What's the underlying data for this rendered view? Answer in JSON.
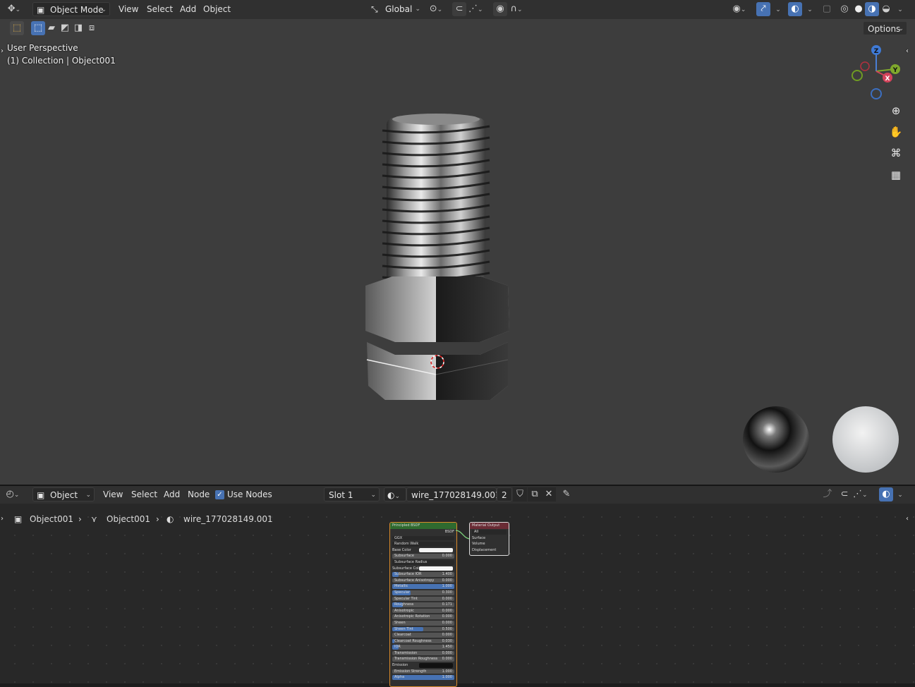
{
  "top_header": {
    "mode": "Object Mode",
    "menus": [
      "View",
      "Select",
      "Add",
      "Object"
    ],
    "orientation": "Global",
    "options": "Options"
  },
  "viewport": {
    "perspective": "User Perspective",
    "collection": "(1) Collection | Object001",
    "gizmo": {
      "z": "Z",
      "y": "Y",
      "x": "X"
    }
  },
  "node_header": {
    "object_type": "Object",
    "menus": [
      "View",
      "Select",
      "Add",
      "Node"
    ],
    "use_nodes": "Use Nodes",
    "slot": "Slot 1",
    "material_name": "wire_177028149.001",
    "user_count": "2"
  },
  "breadcrumb": [
    "Object001",
    "Object001",
    "wire_177028149.001"
  ],
  "nodes": {
    "principled": {
      "title": "Principled BSDF",
      "output": "BSDF",
      "rows": [
        {
          "label": "GGX",
          "kind": "select",
          "value": ""
        },
        {
          "label": "Random Walk",
          "kind": "select",
          "value": ""
        },
        {
          "label": "Base Color",
          "kind": "color",
          "value": ""
        },
        {
          "label": "Subsurface",
          "kind": "num",
          "value": "0.000",
          "fill": 0
        },
        {
          "label": "Subsurface Radius",
          "kind": "select",
          "value": ""
        },
        {
          "label": "Subsurface Color",
          "kind": "color",
          "value": ""
        },
        {
          "label": "Subsurface IOR",
          "kind": "num",
          "value": "1.400",
          "fill": 0.1
        },
        {
          "label": "Subsurface Anisotropy",
          "kind": "num",
          "value": "0.000",
          "fill": 0
        },
        {
          "label": "Metallic",
          "kind": "num",
          "value": "1.000",
          "fill": 1
        },
        {
          "label": "Specular",
          "kind": "num",
          "value": "0.300",
          "fill": 0.3
        },
        {
          "label": "Specular Tint",
          "kind": "num",
          "value": "0.000",
          "fill": 0
        },
        {
          "label": "Roughness",
          "kind": "num",
          "value": "0.171",
          "fill": 0.17
        },
        {
          "label": "Anisotropic",
          "kind": "num",
          "value": "0.000",
          "fill": 0
        },
        {
          "label": "Anisotropic Rotation",
          "kind": "num",
          "value": "0.000",
          "fill": 0
        },
        {
          "label": "Sheen",
          "kind": "num",
          "value": "0.000",
          "fill": 0
        },
        {
          "label": "Sheen Tint",
          "kind": "num",
          "value": "0.500",
          "fill": 0.5
        },
        {
          "label": "Clearcoat",
          "kind": "num",
          "value": "0.000",
          "fill": 0
        },
        {
          "label": "Clearcoat Roughness",
          "kind": "num",
          "value": "0.030",
          "fill": 0.03
        },
        {
          "label": "IOR",
          "kind": "num",
          "value": "1.450",
          "fill": 0.1
        },
        {
          "label": "Transmission",
          "kind": "num",
          "value": "0.000",
          "fill": 0
        },
        {
          "label": "Transmission Roughness",
          "kind": "num",
          "value": "0.000",
          "fill": 0
        },
        {
          "label": "Emission",
          "kind": "color-dark",
          "value": ""
        },
        {
          "label": "Emission Strength",
          "kind": "num",
          "value": "1.000",
          "fill": 0
        },
        {
          "label": "Alpha",
          "kind": "num",
          "value": "1.000",
          "fill": 1
        }
      ]
    },
    "output": {
      "title": "Material Output",
      "target": "All",
      "sockets": [
        "Surface",
        "Volume",
        "Displacement"
      ]
    }
  },
  "colors": {
    "accent": "#4772b3",
    "node_green": "#2f6a2f",
    "node_red": "#6a2c35",
    "viewport_bg": "#3d3d3d"
  }
}
